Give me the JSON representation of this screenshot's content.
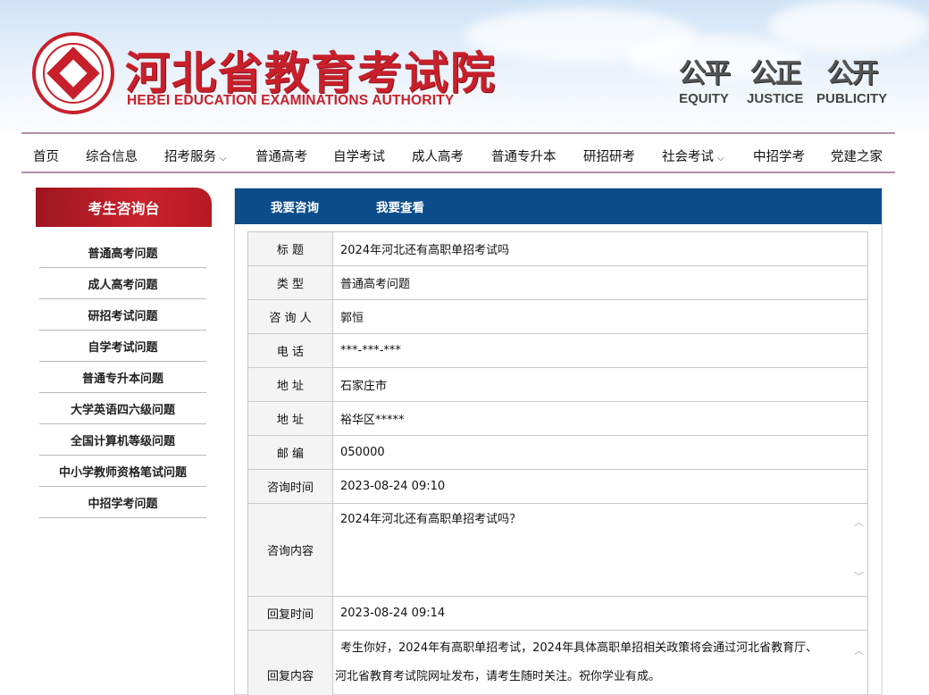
{
  "header": {
    "title": "河北省教育考试院",
    "subtitle": "HEBEI EDUCATION EXAMINATIONS AUTHORITY",
    "mottos": [
      {
        "cn": "公平",
        "en": "EQUITY"
      },
      {
        "cn": "公正",
        "en": "JUSTICE"
      },
      {
        "cn": "公开",
        "en": "PUBLICITY"
      }
    ]
  },
  "nav": [
    {
      "label": "首页"
    },
    {
      "label": "综合信息"
    },
    {
      "label": "招考服务",
      "chevron": "⌵"
    },
    {
      "label": "普通高考"
    },
    {
      "label": "自学考试"
    },
    {
      "label": "成人高考"
    },
    {
      "label": "普通专升本"
    },
    {
      "label": "研招研考"
    },
    {
      "label": "社会考试",
      "chevron": "⌵"
    },
    {
      "label": "中招学考"
    },
    {
      "label": "党建之家"
    }
  ],
  "sidebar": {
    "title": "考生咨询台",
    "items": [
      "普通高考问题",
      "成人高考问题",
      "研招考试问题",
      "自学考试问题",
      "普通专升本问题",
      "大学英语四六级问题",
      "全国计算机等级问题",
      "中小学教师资格笔试问题",
      "中招学考问题"
    ]
  },
  "tabs": [
    "我要咨询",
    "我要查看"
  ],
  "detail": {
    "rows": [
      {
        "label": "标  题",
        "value": "2024年河北还有高职单招考试吗"
      },
      {
        "label": "类  型",
        "value": "普通高考问题"
      },
      {
        "label": "咨 询 人",
        "value": "郭恒"
      },
      {
        "label": "电  话",
        "value": "***-***-***"
      },
      {
        "label": "地  址",
        "value": "石家庄市"
      },
      {
        "label": "地  址",
        "value": "裕华区*****"
      },
      {
        "label": "邮  编",
        "value": "050000"
      },
      {
        "label": "咨询时间",
        "value": "2023-08-24 09:10"
      }
    ],
    "content_label": "咨询内容",
    "content_value": "2024年河北还有高职单招考试吗？",
    "reply_time_label": "回复时间",
    "reply_time_value": "2023-08-24 09:14",
    "reply_label": "回复内容",
    "reply_line1": "考生你好，2024年有高职单招考试，2024年具体高职单招相关政策将会通过河北省教育厅、",
    "reply_line2": "河北省教育考试院网址发布，请考生随时关注。祝你学业有成。"
  },
  "colors": {
    "brand_red": "#c8202b",
    "nav_border": "#b58ea8",
    "tab_blue": "#0b4d8a"
  }
}
